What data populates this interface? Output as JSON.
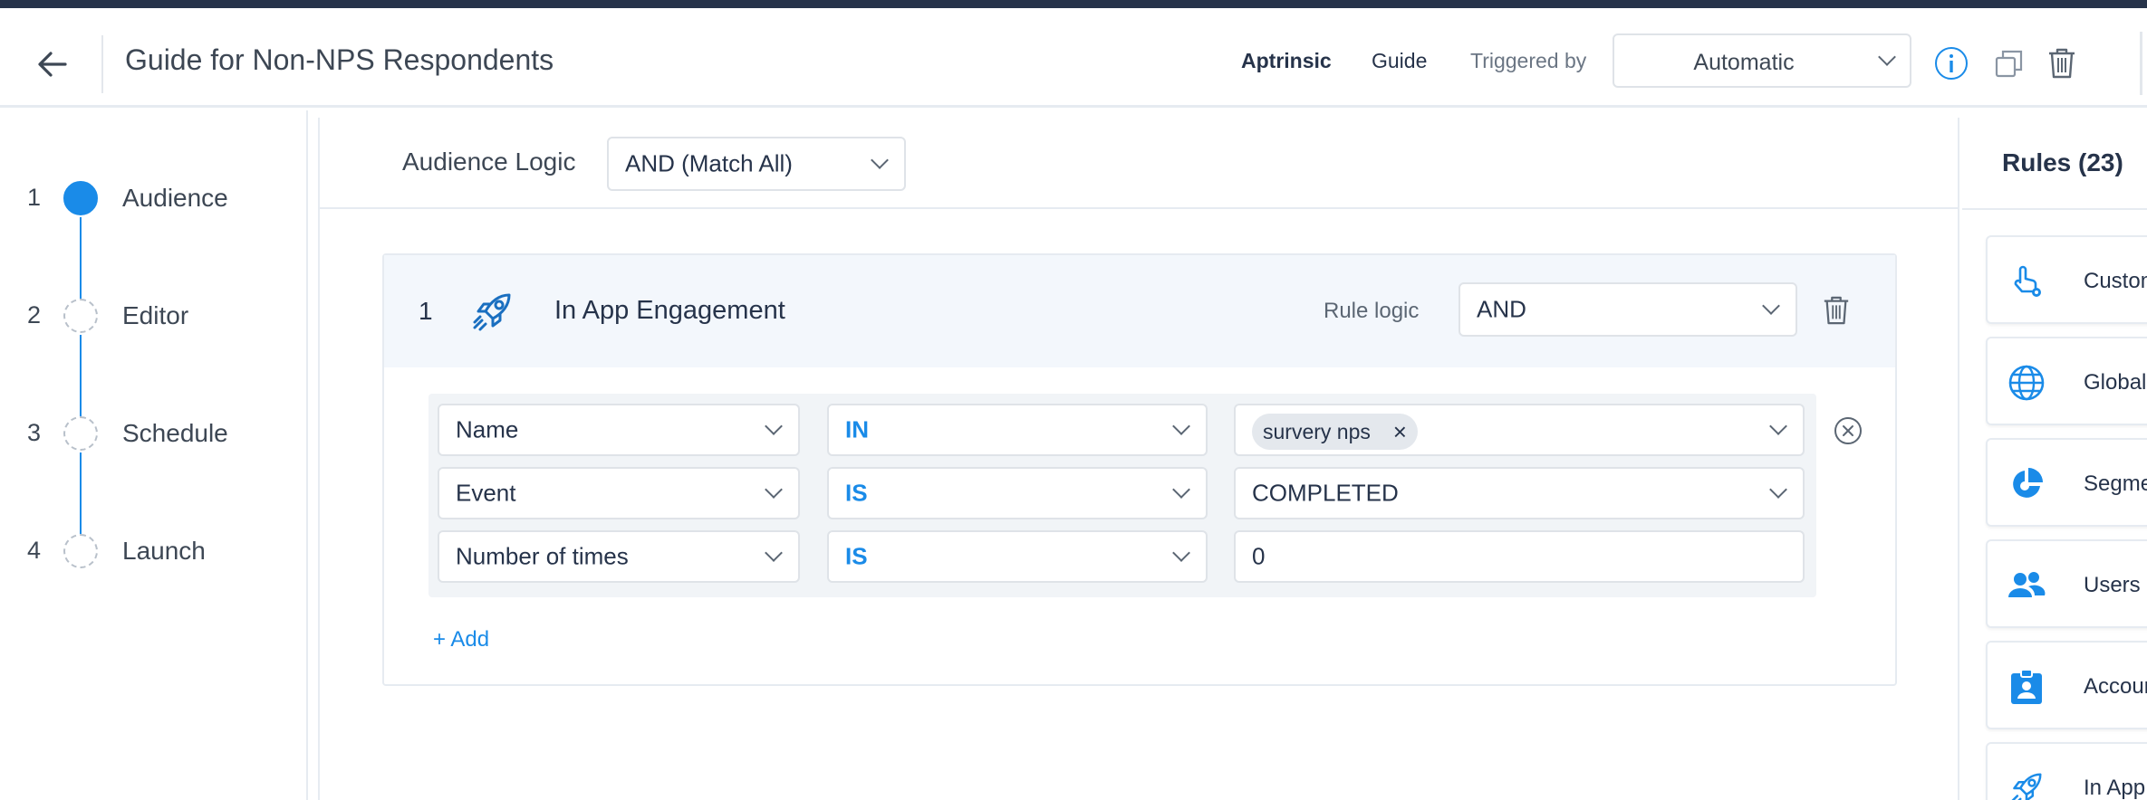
{
  "header": {
    "title": "Guide for Non-NPS Respondents",
    "product": "Aptrinsic",
    "type": "Guide",
    "triggered_by_label": "Triggered by",
    "triggered_by_value": "Automatic"
  },
  "steps": [
    {
      "num": "1",
      "label": "Audience",
      "active": true
    },
    {
      "num": "2",
      "label": "Editor",
      "active": false
    },
    {
      "num": "3",
      "label": "Schedule",
      "active": false
    },
    {
      "num": "4",
      "label": "Launch",
      "active": false
    }
  ],
  "audience": {
    "logic_label": "Audience Logic",
    "logic_value": "AND (Match All)"
  },
  "rule": {
    "number": "1",
    "name": "In App Engagement",
    "logic_label": "Rule logic",
    "logic_value": "AND",
    "conditions": [
      {
        "field": "Name",
        "operator": "IN",
        "value": "survery nps",
        "value_is_tag": true
      },
      {
        "field": "Event",
        "operator": "IS",
        "value": "COMPLETED",
        "value_is_tag": false
      },
      {
        "field": "Number of times",
        "operator": "IS",
        "value": "0",
        "value_is_tag": false
      }
    ],
    "add_label": "+ Add"
  },
  "rules_panel": {
    "title": "Rules (23)",
    "items": [
      {
        "label": "Custom",
        "icon": "pointer-gear-icon"
      },
      {
        "label": "Global",
        "icon": "globe-icon"
      },
      {
        "label": "Segments",
        "icon": "pie-chart-icon"
      },
      {
        "label": "Users",
        "icon": "users-icon"
      },
      {
        "label": "Accounts",
        "icon": "account-badge-icon"
      },
      {
        "label": "In App",
        "icon": "rocket-icon"
      }
    ]
  },
  "colors": {
    "accent": "#1a8be8",
    "header_strip": "#26334a",
    "rule_header_bg": "#f3f7fc"
  }
}
